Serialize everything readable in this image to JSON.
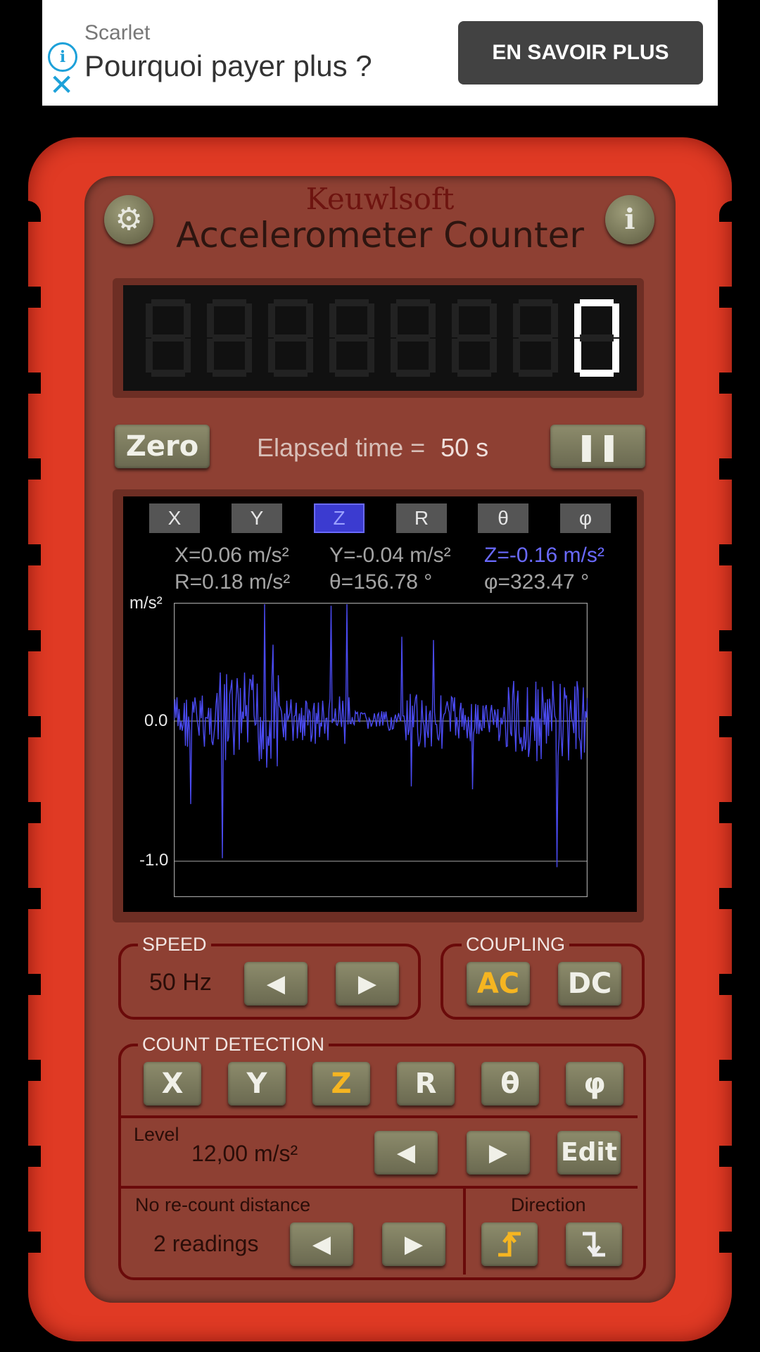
{
  "ad": {
    "info_glyph": "i",
    "close_glyph": "✕",
    "brand": "Scarlet",
    "headline": "Pourquoi payer plus ?",
    "cta": "EN SAVOIR PLUS"
  },
  "header": {
    "brand": "Keuwlsoft",
    "title": "Accelerometer Counter",
    "settings_icon": "⚙",
    "info_label": "i"
  },
  "counter": {
    "value": "0"
  },
  "controls": {
    "zero_label": "Zero",
    "elapsed_label": "Elapsed time =",
    "elapsed_value": "50 s",
    "pause_label": "❚❚"
  },
  "graph": {
    "tabs": [
      "X",
      "Y",
      "Z",
      "R",
      "θ",
      "φ"
    ],
    "selected_tab": "Z",
    "readings": {
      "x": "X=0.06 m/s²",
      "y": "Y=-0.04 m/s²",
      "z": "Z=-0.16 m/s²",
      "r": "R=0.18 m/s²",
      "theta": "θ=156.78 °",
      "phi": "φ=323.47 °"
    },
    "y_unit": "m/s²",
    "y_ticks": [
      "0.0",
      "-1.0"
    ],
    "trace_color": "#4a4af0"
  },
  "speed": {
    "title": "SPEED",
    "value": "50 Hz",
    "left": "◀",
    "right": "▶"
  },
  "coupling": {
    "title": "COUPLING",
    "ac": "AC",
    "dc": "DC"
  },
  "count_detection": {
    "title": "COUNT DETECTION",
    "axes": [
      "X",
      "Y",
      "Z",
      "R",
      "θ",
      "φ"
    ],
    "selected_axis": "Z",
    "level_label": "Level",
    "level_value": "12,00 m/s²",
    "level_left": "◀",
    "level_right": "▶",
    "edit_label": "Edit",
    "recount_label": "No re-count distance",
    "recount_value": "2 readings",
    "recount_left": "◀",
    "recount_right": "▶",
    "direction_label": "Direction"
  },
  "colors": {
    "casing": "#e03a24",
    "face": "#8e4033",
    "accent_yellow": "#f5b521",
    "selected_blue": "#6a6aff"
  }
}
